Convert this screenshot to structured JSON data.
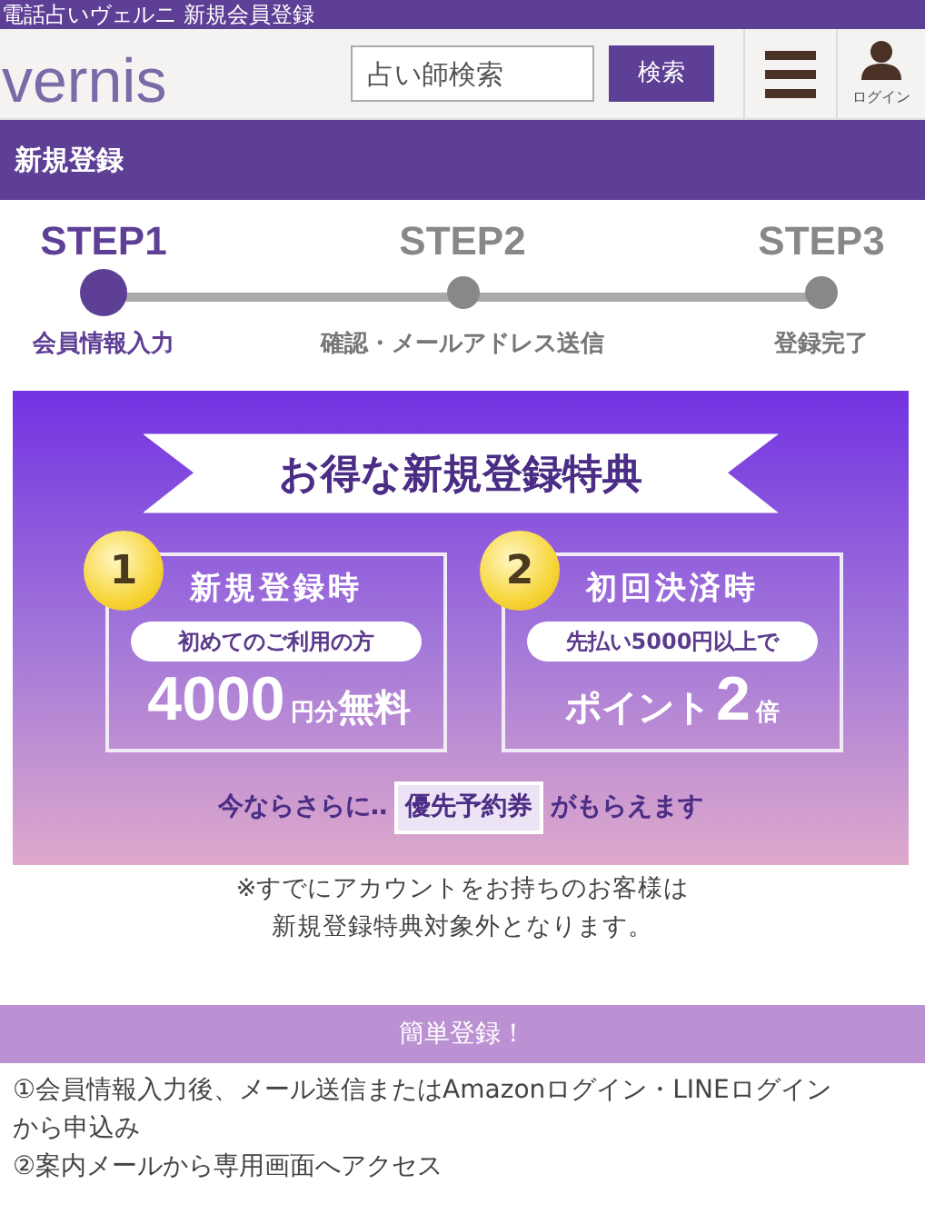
{
  "browser_title": "電話占いヴェルニ 新規会員登録",
  "header": {
    "logo": "vernis",
    "search": {
      "placeholder": "占い師検索",
      "button": "検索"
    },
    "login": "ログイン"
  },
  "page_title": "新規登録",
  "steps": [
    {
      "step": "STEP1",
      "label": "会員情報入力",
      "selected": true
    },
    {
      "step": "STEP2",
      "label": "確認・メールアドレス送信",
      "selected": false
    },
    {
      "step": "STEP3",
      "label": "登録完了",
      "selected": false
    }
  ],
  "banner": {
    "title": "お得な新規登録特典",
    "benefits": [
      {
        "number": "1",
        "heading": "新規登録時",
        "condition": "初めてのご利用の方",
        "reward": [
          {
            "text": "4000",
            "kind": "number"
          },
          {
            "text": "円分",
            "kind": "unit"
          },
          {
            "text": "無料",
            "kind": "word"
          }
        ]
      },
      {
        "number": "2",
        "heading": "初回決済時",
        "condition": "先払い5000円以上で",
        "reward": [
          {
            "text": "ポイント",
            "kind": "word"
          },
          {
            "text": "2",
            "kind": "number"
          },
          {
            "text": "倍",
            "kind": "unit"
          }
        ]
      }
    ],
    "bonus": [
      {
        "text": "今ならさらに‥",
        "kind": "text"
      },
      {
        "text": "優先予約券",
        "kind": "ticket"
      },
      {
        "text": "がもらえます",
        "kind": "text"
      }
    ]
  },
  "note": [
    "※すでにアカウントをお持ちのお客様は",
    "新規登録特典対象外となります。"
  ],
  "section": {
    "title": "簡単登録！",
    "items": [
      "①会員情報入力後、メール送信またはAmazonログイン・LINEログインから申込み",
      "②案内メールから専用画面へアクセス"
    ]
  }
}
